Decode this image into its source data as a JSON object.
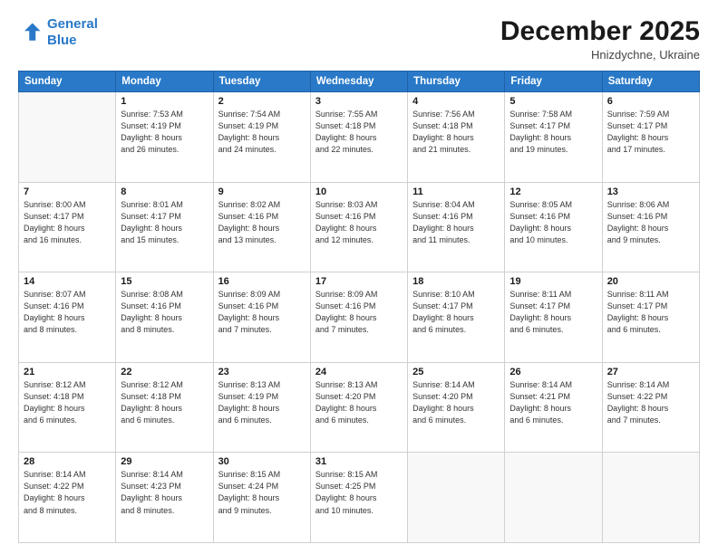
{
  "header": {
    "logo_line1": "General",
    "logo_line2": "Blue",
    "month": "December 2025",
    "location": "Hnizdychne, Ukraine"
  },
  "weekdays": [
    "Sunday",
    "Monday",
    "Tuesday",
    "Wednesday",
    "Thursday",
    "Friday",
    "Saturday"
  ],
  "weeks": [
    [
      {
        "day": "",
        "info": ""
      },
      {
        "day": "1",
        "info": "Sunrise: 7:53 AM\nSunset: 4:19 PM\nDaylight: 8 hours\nand 26 minutes."
      },
      {
        "day": "2",
        "info": "Sunrise: 7:54 AM\nSunset: 4:19 PM\nDaylight: 8 hours\nand 24 minutes."
      },
      {
        "day": "3",
        "info": "Sunrise: 7:55 AM\nSunset: 4:18 PM\nDaylight: 8 hours\nand 22 minutes."
      },
      {
        "day": "4",
        "info": "Sunrise: 7:56 AM\nSunset: 4:18 PM\nDaylight: 8 hours\nand 21 minutes."
      },
      {
        "day": "5",
        "info": "Sunrise: 7:58 AM\nSunset: 4:17 PM\nDaylight: 8 hours\nand 19 minutes."
      },
      {
        "day": "6",
        "info": "Sunrise: 7:59 AM\nSunset: 4:17 PM\nDaylight: 8 hours\nand 17 minutes."
      }
    ],
    [
      {
        "day": "7",
        "info": ""
      },
      {
        "day": "8",
        "info": "Sunrise: 8:01 AM\nSunset: 4:17 PM\nDaylight: 8 hours\nand 15 minutes."
      },
      {
        "day": "9",
        "info": "Sunrise: 8:02 AM\nSunset: 4:16 PM\nDaylight: 8 hours\nand 13 minutes."
      },
      {
        "day": "10",
        "info": "Sunrise: 8:03 AM\nSunset: 4:16 PM\nDaylight: 8 hours\nand 12 minutes."
      },
      {
        "day": "11",
        "info": "Sunrise: 8:04 AM\nSunset: 4:16 PM\nDaylight: 8 hours\nand 11 minutes."
      },
      {
        "day": "12",
        "info": "Sunrise: 8:05 AM\nSunset: 4:16 PM\nDaylight: 8 hours\nand 10 minutes."
      },
      {
        "day": "13",
        "info": "Sunrise: 8:06 AM\nSunset: 4:16 PM\nDaylight: 8 hours\nand 9 minutes."
      }
    ],
    [
      {
        "day": "14",
        "info": ""
      },
      {
        "day": "15",
        "info": "Sunrise: 8:08 AM\nSunset: 4:16 PM\nDaylight: 8 hours\nand 8 minutes."
      },
      {
        "day": "16",
        "info": "Sunrise: 8:09 AM\nSunset: 4:16 PM\nDaylight: 8 hours\nand 7 minutes."
      },
      {
        "day": "17",
        "info": "Sunrise: 8:09 AM\nSunset: 4:16 PM\nDaylight: 8 hours\nand 7 minutes."
      },
      {
        "day": "18",
        "info": "Sunrise: 8:10 AM\nSunset: 4:17 PM\nDaylight: 8 hours\nand 6 minutes."
      },
      {
        "day": "19",
        "info": "Sunrise: 8:11 AM\nSunset: 4:17 PM\nDaylight: 8 hours\nand 6 minutes."
      },
      {
        "day": "20",
        "info": "Sunrise: 8:11 AM\nSunset: 4:17 PM\nDaylight: 8 hours\nand 6 minutes."
      }
    ],
    [
      {
        "day": "21",
        "info": ""
      },
      {
        "day": "22",
        "info": "Sunrise: 8:12 AM\nSunset: 4:18 PM\nDaylight: 8 hours\nand 6 minutes."
      },
      {
        "day": "23",
        "info": "Sunrise: 8:13 AM\nSunset: 4:19 PM\nDaylight: 8 hours\nand 6 minutes."
      },
      {
        "day": "24",
        "info": "Sunrise: 8:13 AM\nSunset: 4:20 PM\nDaylight: 8 hours\nand 6 minutes."
      },
      {
        "day": "25",
        "info": "Sunrise: 8:14 AM\nSunset: 4:20 PM\nDaylight: 8 hours\nand 6 minutes."
      },
      {
        "day": "26",
        "info": "Sunrise: 8:14 AM\nSunset: 4:21 PM\nDaylight: 8 hours\nand 6 minutes."
      },
      {
        "day": "27",
        "info": "Sunrise: 8:14 AM\nSunset: 4:22 PM\nDaylight: 8 hours\nand 7 minutes."
      }
    ],
    [
      {
        "day": "28",
        "info": "Sunrise: 8:14 AM\nSunset: 4:22 PM\nDaylight: 8 hours\nand 8 minutes."
      },
      {
        "day": "29",
        "info": "Sunrise: 8:14 AM\nSunset: 4:23 PM\nDaylight: 8 hours\nand 8 minutes."
      },
      {
        "day": "30",
        "info": "Sunrise: 8:15 AM\nSunset: 4:24 PM\nDaylight: 8 hours\nand 9 minutes."
      },
      {
        "day": "31",
        "info": "Sunrise: 8:15 AM\nSunset: 4:25 PM\nDaylight: 8 hours\nand 10 minutes."
      },
      {
        "day": "",
        "info": ""
      },
      {
        "day": "",
        "info": ""
      },
      {
        "day": "",
        "info": ""
      }
    ]
  ],
  "week7_sunday": "Sunrise: 8:00 AM\nSunset: 4:17 PM\nDaylight: 8 hours\nand 16 minutes.",
  "week14_sunday": "Sunrise: 8:07 AM\nSunset: 4:16 PM\nDaylight: 8 hours\nand 8 minutes.",
  "week21_sunday": "Sunrise: 8:12 AM\nSunset: 4:18 PM\nDaylight: 8 hours\nand 6 minutes."
}
